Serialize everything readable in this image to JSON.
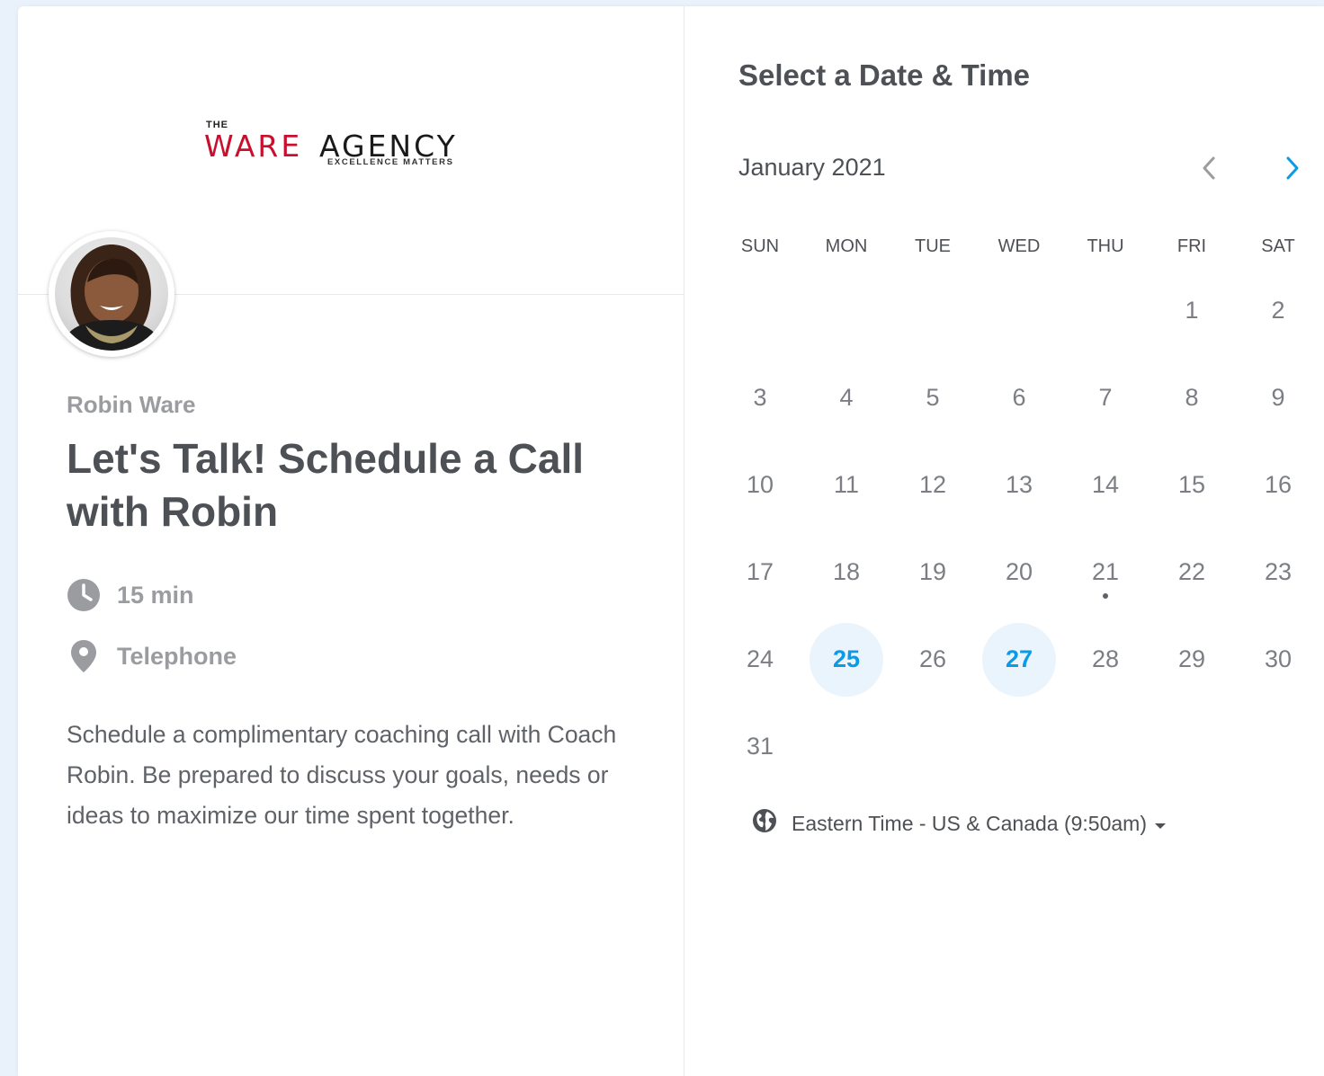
{
  "brand": {
    "the": "THE",
    "ware": "WARE",
    "agency": "AGENCY",
    "tagline": "EXCELLENCE MATTERS"
  },
  "event": {
    "owner": "Robin Ware",
    "title": "Let's Talk! Schedule a Call with Robin",
    "duration": "15 min",
    "location": "Telephone",
    "description": "Schedule a complimentary coaching call with Coach Robin. Be prepared to discuss your goals, needs or ideas to maximize our time spent together.",
    "duration_icon": "clock-icon",
    "location_icon": "map-pin-icon"
  },
  "calendar": {
    "heading": "Select a Date & Time",
    "month_label": "January 2021",
    "prev_icon": "chevron-left-icon",
    "next_icon": "chevron-right-icon",
    "weekdays": [
      "SUN",
      "MON",
      "TUE",
      "WED",
      "THU",
      "FRI",
      "SAT"
    ],
    "weeks": [
      [
        "",
        "",
        "",
        "",
        "",
        "1",
        "2"
      ],
      [
        "3",
        "4",
        "5",
        "6",
        "7",
        "8",
        "9"
      ],
      [
        "10",
        "11",
        "12",
        "13",
        "14",
        "15",
        "16"
      ],
      [
        "17",
        "18",
        "19",
        "20",
        "21",
        "22",
        "23"
      ],
      [
        "24",
        "25",
        "26",
        "27",
        "28",
        "29",
        "30"
      ],
      [
        "31",
        "",
        "",
        "",
        "",
        "",
        ""
      ]
    ],
    "available_dates": [
      "25",
      "27"
    ],
    "today": "21"
  },
  "timezone": {
    "label": "Eastern Time - US & Canada (9:50am)",
    "icon": "globe-icon"
  },
  "colors": {
    "accent": "#0a9ae6",
    "available_bg": "#eaf4fd",
    "text": "#4d5055",
    "muted": "#9a9ca0",
    "brand_red": "#c8102e",
    "page_bg": "#e9f1fb"
  }
}
